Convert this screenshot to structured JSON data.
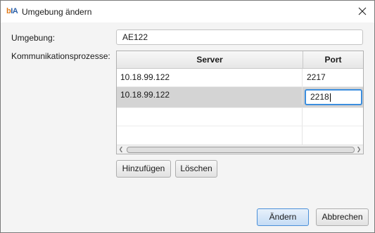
{
  "window": {
    "title": "Umgebung ändern",
    "app_logo": "bIA"
  },
  "form": {
    "environment_label": "Umgebung:",
    "environment_value": "AE122",
    "processes_label": "Kommunikationsprozesse:"
  },
  "table": {
    "columns": [
      "Server",
      "Port"
    ],
    "rows": [
      {
        "server": "10.18.99.122",
        "port": "2217"
      },
      {
        "server": "10.18.99.122",
        "port": "2218"
      }
    ]
  },
  "buttons": {
    "add": "Hinzufügen",
    "delete": "Löschen",
    "change": "Ändern",
    "cancel": "Abbrechen"
  },
  "icons": {
    "close": "close-icon",
    "app": "bia-logo-icon"
  },
  "colors": {
    "accent": "#3c8ede",
    "selected_row": "#d4d4d4",
    "background": "#f4f4f4"
  }
}
